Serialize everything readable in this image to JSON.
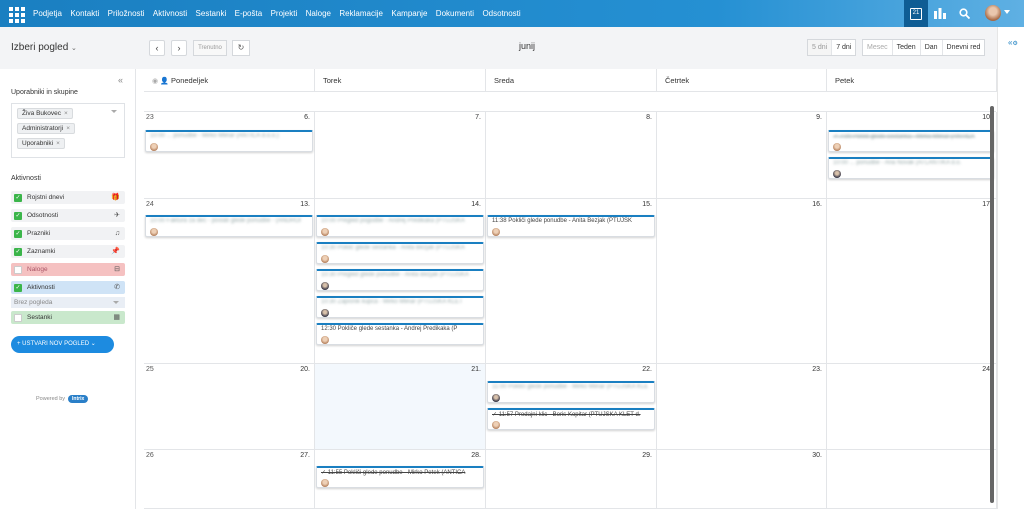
{
  "topbar": {
    "menu": [
      "Podjetja",
      "Kontakti",
      "Priložnosti",
      "Aktivnosti",
      "Sestanki",
      "E-pošta",
      "Projekti",
      "Naloge",
      "Reklamacije",
      "Kampanje",
      "Dokumenti",
      "Odsotnosti"
    ],
    "calendar_icon_text": "21"
  },
  "toolbar": {
    "view_select": "Izberi pogled",
    "prev": "‹",
    "next": "›",
    "today": "Trenutno",
    "refresh": "↻",
    "month": "junij",
    "range_options": [
      "5 dni",
      "7 dni"
    ],
    "mode_options": [
      "Mesec",
      "Teden",
      "Dan",
      "Dnevni red"
    ]
  },
  "sidebar": {
    "collapse": "«",
    "users_title": "Uporabniki in skupine",
    "tags": [
      "Živa Bukovec",
      "Administratorji",
      "Uporabniki"
    ],
    "activities_title": "Aktivnosti",
    "activities": [
      {
        "label": "Rojstni dnevi",
        "icon": "🎁",
        "checked": true
      },
      {
        "label": "Odsotnosti",
        "icon": "✈",
        "checked": true
      },
      {
        "label": "Prazniki",
        "icon": "♫",
        "checked": true
      },
      {
        "label": "Zaznamki",
        "icon": "📌",
        "checked": true
      },
      {
        "label": "Naloge",
        "icon": "⊟",
        "checked": false
      },
      {
        "label": "Aktivnosti",
        "icon": "✆",
        "checked": true
      },
      {
        "label": "Sestanki",
        "icon": "▦",
        "checked": false
      }
    ],
    "brez_pogleda": "Brez pogleda",
    "new_view": "+ USTVARI NOV POGLED",
    "powered": "Powered by",
    "powered_logo": "Intrix"
  },
  "calendar": {
    "days": [
      "Ponedeljek",
      "Torek",
      "Sreda",
      "Četrtek",
      "Petek"
    ],
    "weeks": [
      {
        "wk": "23",
        "dates": [
          "6.",
          "7.",
          "8.",
          "9.",
          "10."
        ]
      },
      {
        "wk": "24",
        "dates": [
          "13.",
          "14.",
          "15.",
          "16.",
          "17."
        ]
      },
      {
        "wk": "25",
        "dates": [
          "20.",
          "21.",
          "22.",
          "23.",
          "24."
        ]
      },
      {
        "wk": "26",
        "dates": [
          "27.",
          "28.",
          "29.",
          "30.",
          ""
        ]
      }
    ],
    "events": {
      "mon6": "10:00 ... ponudbe - Mirko Mlinar (ANTICA d.o.o.)",
      "fri10a": "✓ 7:00 Poklič glede sestanka - Mirko Mlinar (ANTICA",
      "fri10b": "10:00 ... ponudbe - Ana Novak (ATLANTIKA d.o.",
      "mon13": "10:00 Faktura za dec - poslati glede ponudbe - (ANDROI",
      "tue14a": "10:00 Pregled pogodbe - Andrej Predikaka (PTUJSKA",
      "tue14b": "10:30 Poklič glede sestanka - Anita Bezjak (PTUJSKA",
      "tue14c": "10:30 Pregled glede ponudbe - Anita Bezjak (PTUJSKA",
      "tue14d": "10:30 Zapisnik kupca - Mirko Mlinar (PTUJSKA KLET",
      "tue14e": "12:30 Pokliče glede sestanka - Andrej Predikaka (P",
      "wed15": "11:38 Pokliči glede ponudbe - Anita Bezjak (PTUJSK",
      "wed22a": "11:00 Pokliči glede ponudbe - Mirko Mlinar (PTUJSKA KLE",
      "wed22b": "✓ 11:57 Prodajni klic - Boris Kopitar (PTUJSKA KLET d.",
      "tue28": "✓ 11:55 Pokliči glede ponudbe - Mirko Petek (ANTICA"
    }
  }
}
